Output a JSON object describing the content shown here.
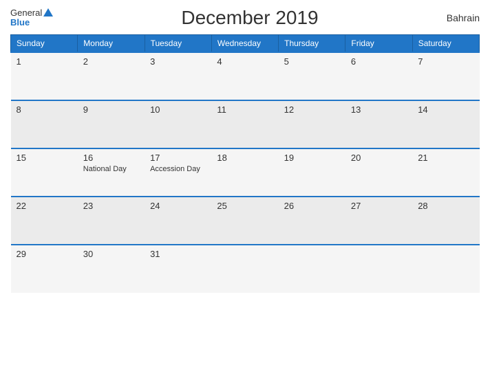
{
  "header": {
    "logo_general": "General",
    "logo_blue": "Blue",
    "title": "December 2019",
    "country": "Bahrain"
  },
  "calendar": {
    "weekdays": [
      "Sunday",
      "Monday",
      "Tuesday",
      "Wednesday",
      "Thursday",
      "Friday",
      "Saturday"
    ],
    "weeks": [
      [
        {
          "day": "1",
          "event": ""
        },
        {
          "day": "2",
          "event": ""
        },
        {
          "day": "3",
          "event": ""
        },
        {
          "day": "4",
          "event": ""
        },
        {
          "day": "5",
          "event": ""
        },
        {
          "day": "6",
          "event": ""
        },
        {
          "day": "7",
          "event": ""
        }
      ],
      [
        {
          "day": "8",
          "event": ""
        },
        {
          "day": "9",
          "event": ""
        },
        {
          "day": "10",
          "event": ""
        },
        {
          "day": "11",
          "event": ""
        },
        {
          "day": "12",
          "event": ""
        },
        {
          "day": "13",
          "event": ""
        },
        {
          "day": "14",
          "event": ""
        }
      ],
      [
        {
          "day": "15",
          "event": ""
        },
        {
          "day": "16",
          "event": "National Day"
        },
        {
          "day": "17",
          "event": "Accession Day"
        },
        {
          "day": "18",
          "event": ""
        },
        {
          "day": "19",
          "event": ""
        },
        {
          "day": "20",
          "event": ""
        },
        {
          "day": "21",
          "event": ""
        }
      ],
      [
        {
          "day": "22",
          "event": ""
        },
        {
          "day": "23",
          "event": ""
        },
        {
          "day": "24",
          "event": ""
        },
        {
          "day": "25",
          "event": ""
        },
        {
          "day": "26",
          "event": ""
        },
        {
          "day": "27",
          "event": ""
        },
        {
          "day": "28",
          "event": ""
        }
      ],
      [
        {
          "day": "29",
          "event": ""
        },
        {
          "day": "30",
          "event": ""
        },
        {
          "day": "31",
          "event": ""
        },
        {
          "day": "",
          "event": ""
        },
        {
          "day": "",
          "event": ""
        },
        {
          "day": "",
          "event": ""
        },
        {
          "day": "",
          "event": ""
        }
      ]
    ]
  }
}
